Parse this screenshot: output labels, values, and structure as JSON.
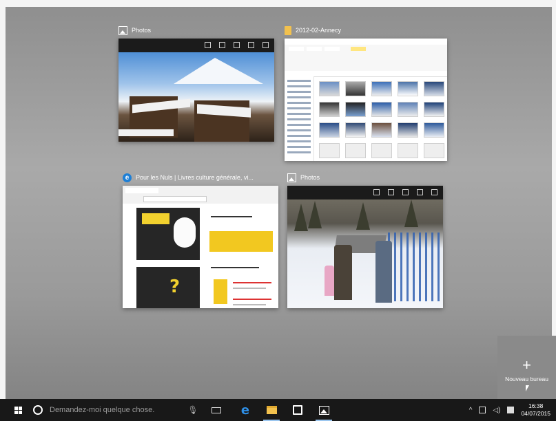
{
  "windows": [
    {
      "title": "Photos",
      "icon": "photos-icon"
    },
    {
      "title": "2012-02-Annecy",
      "icon": "folder-icon"
    },
    {
      "title": "Pour les Nuls | Livres culture générale, vi...",
      "icon": "edge-icon"
    },
    {
      "title": "Photos",
      "icon": "photos-icon"
    }
  ],
  "new_desktop": {
    "plus": "+",
    "label": "Nouveau bureau"
  },
  "taskbar": {
    "search_placeholder": "Demandez-moi quelque chose.",
    "pinned": [
      "task-view-icon",
      "edge-icon",
      "file-explorer-icon",
      "store-icon",
      "photos-icon"
    ],
    "tray": {
      "up_arrow": "^",
      "time": "16:38",
      "date": "04/07/2015"
    }
  },
  "colors": {
    "taskbar": "#181818",
    "accent": "#2e8fe6",
    "folder": "#f2c14e"
  }
}
